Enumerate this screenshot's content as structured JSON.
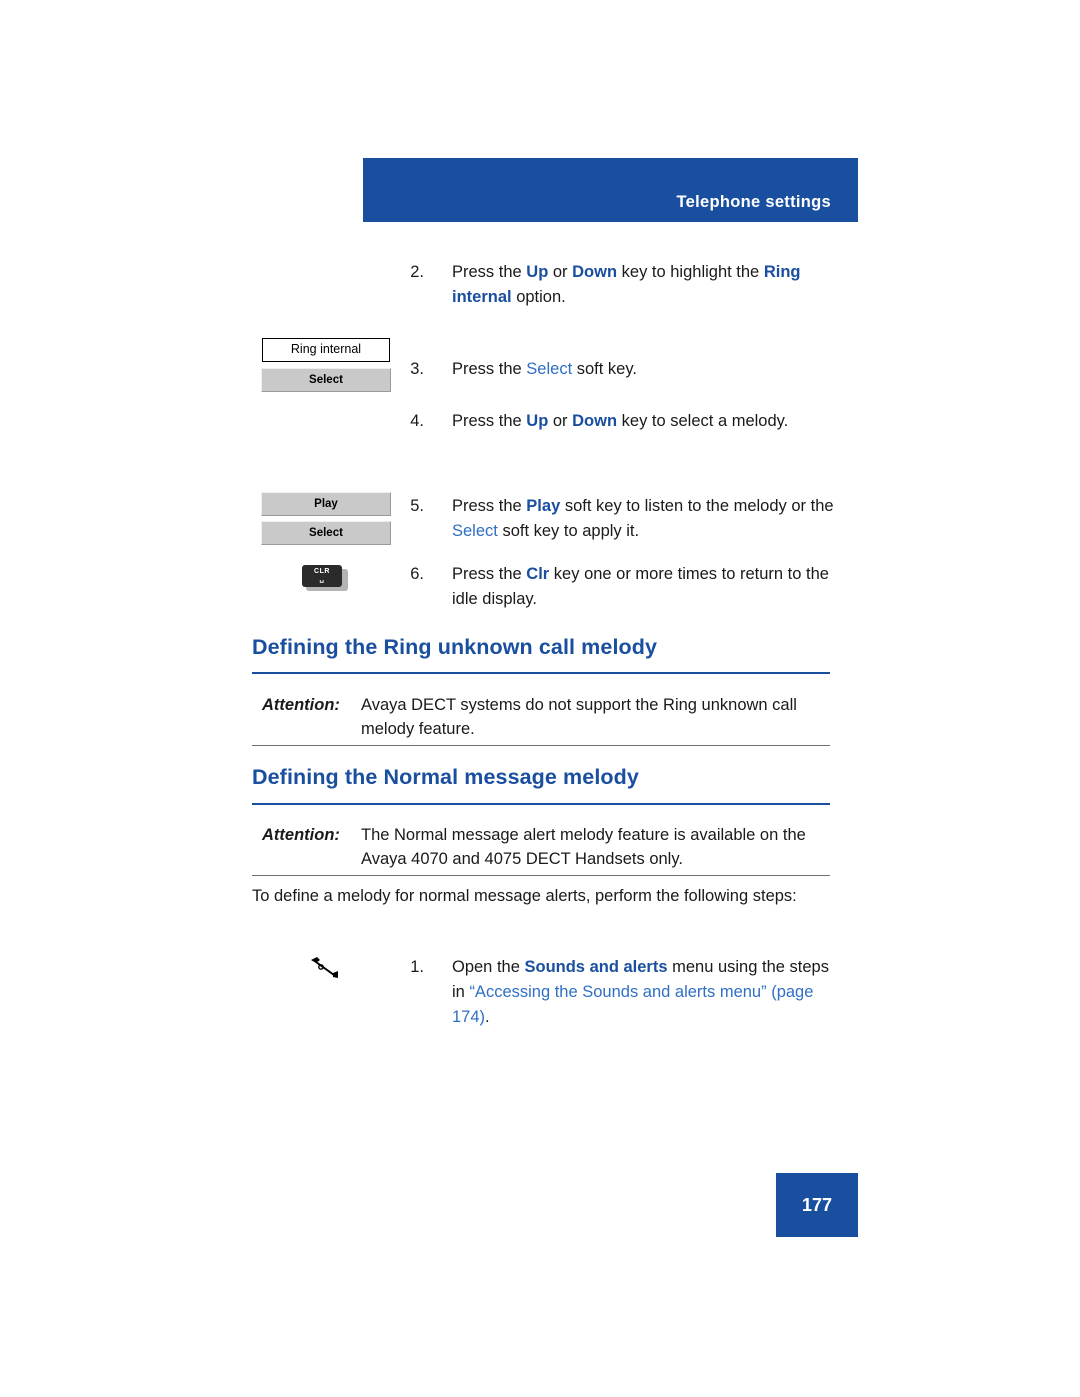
{
  "header": {
    "title": "Telephone settings"
  },
  "steps": {
    "s2": {
      "num": "2.",
      "p1": "Press the ",
      "b1": "Up",
      "p2": " or ",
      "b2": "Down",
      "p3": " key to highlight the ",
      "b3": "Ring internal",
      "p4": " option."
    },
    "s3": {
      "num": "3.",
      "p1": "Press the ",
      "b1": "Select",
      "p2": " soft key."
    },
    "s4": {
      "num": "4.",
      "p1": "Press the ",
      "b1": "Up",
      "p2": " or ",
      "b2": "Down",
      "p3": " key to select a melody."
    },
    "s5": {
      "num": "5.",
      "p1": "Press the ",
      "b1": "Play",
      "p2": " soft key to listen to the melody or the ",
      "b2": "Select",
      "p3": " soft key to apply it."
    },
    "s6": {
      "num": "6.",
      "p1": "Press the ",
      "b1": "Clr",
      "p2": " key one or more times to return to the idle display."
    },
    "s1b": {
      "num": "1.",
      "p1": "Open the ",
      "b1": "Sounds and alerts",
      "p2": " menu using the steps in ",
      "link1": "“Accessing the Sounds and alerts menu”",
      "p3": " ",
      "link2": "(page 174)",
      "p4": "."
    }
  },
  "graphics": {
    "lcd_ring_internal": "Ring internal",
    "softkey_select_1": "Select",
    "softkey_play": "Play",
    "softkey_select_2": "Select",
    "clr_key_line1": "CLR",
    "clr_key_line2": "␣"
  },
  "sections": {
    "ring_unknown": {
      "heading": "Defining the Ring unknown call melody",
      "attention_label": "Attention:",
      "attention_text": "Avaya DECT systems do not support the Ring unknown call melody feature."
    },
    "normal_message": {
      "heading": "Defining the Normal message melody",
      "attention_label": "Attention:",
      "attention_text": "The Normal message alert melody feature is available on the Avaya 4070 and 4075 DECT Handsets only.",
      "intro": "To define a melody for normal message alerts, perform the following steps:"
    }
  },
  "footer": {
    "page_number": "177"
  },
  "colors": {
    "brand_blue": "#1a4fa0",
    "link_blue": "#2f6fc4"
  }
}
